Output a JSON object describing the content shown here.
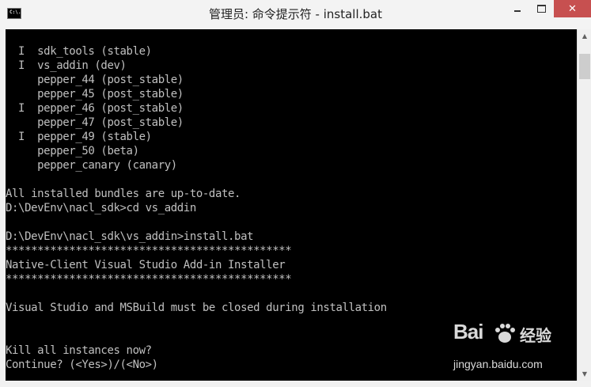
{
  "window": {
    "title": "管理员: 命令提示符 - install.bat",
    "icon": "console-icon",
    "icon_text": "C:\\.",
    "controls": {
      "minimize": "minimize-icon",
      "maximize": "maximize-icon",
      "close": "✕"
    }
  },
  "console": {
    "lines": [
      "  I  sdk_tools (stable)",
      "  I  vs_addin (dev)",
      "     pepper_44 (post_stable)",
      "     pepper_45 (post_stable)",
      "  I  pepper_46 (post_stable)",
      "     pepper_47 (post_stable)",
      "  I  pepper_49 (stable)",
      "     pepper_50 (beta)",
      "     pepper_canary (canary)",
      "",
      "All installed bundles are up-to-date.",
      "D:\\DevEnv\\nacl_sdk>cd vs_addin",
      "",
      "D:\\DevEnv\\nacl_sdk\\vs_addin>install.bat",
      "*********************************************",
      "Native-Client Visual Studio Add-in Installer",
      "*********************************************",
      "",
      "Visual Studio and MSBuild must be closed during installation",
      "",
      "",
      "Kill all instances now?",
      "Continue? (<Yes>)/(<No>)"
    ]
  },
  "scrollbar": {
    "up": "▲",
    "down": "▼"
  },
  "watermark": {
    "logo": "Bai",
    "paw_icon": "paw-icon",
    "cn": "经验",
    "url": "jingyan.baidu.com"
  },
  "colors": {
    "console_bg": "#000000",
    "console_text": "#c0c0c0",
    "close_button": "#c75050"
  }
}
